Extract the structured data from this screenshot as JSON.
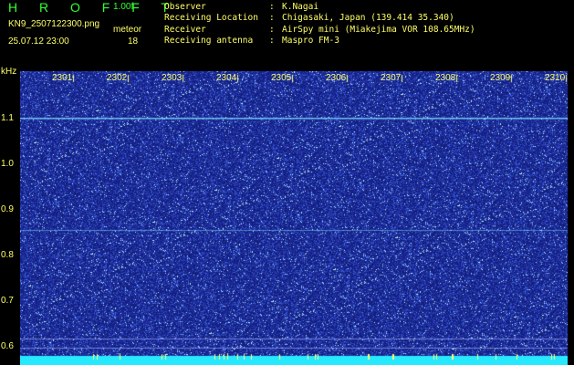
{
  "header": {
    "app_title": "H R O F F T",
    "version": "1.00f",
    "filename": "KN9_2507122300.png",
    "datetime": "25.07.12 23:00",
    "meteor_label": "meteor",
    "meteor_count": "18"
  },
  "info": [
    {
      "key": "Observer",
      "value": "K.Nagai"
    },
    {
      "key": "Receiving Location",
      "value": "Chigasaki, Japan (139.414 35.340)"
    },
    {
      "key": "Receiver",
      "value": "AirSpy mini (Miakejima VOR 108.65MHz)"
    },
    {
      "key": "Receiving antenna",
      "value": "Maspro FM-3"
    }
  ],
  "axis": {
    "unit": "kHz",
    "y_labels": [
      "1.1",
      "1.0",
      "0.9",
      "0.8",
      "0.7",
      "0.6"
    ],
    "x_labels": [
      "2301",
      "2302",
      "2303",
      "2304",
      "2305",
      "2306",
      "2307",
      "2308",
      "2309",
      "2310"
    ]
  },
  "colors": {
    "background": "#1a2a8a",
    "noise": "#3b56d8",
    "signal": "#7fdfff",
    "bottom_band": "#26e8ff",
    "text": "#ffff66",
    "title": "#33ff33"
  }
}
